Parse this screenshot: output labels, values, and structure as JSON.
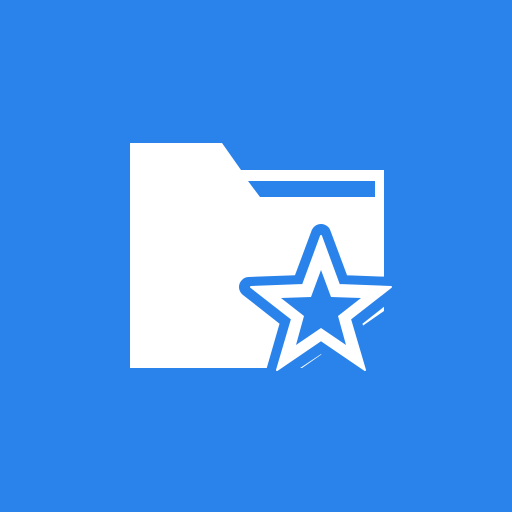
{
  "icon": {
    "name": "starred-folder-icon",
    "parts": [
      "folder-icon",
      "star-icon"
    ]
  },
  "colors": {
    "background": "#2A83EA",
    "foreground": "#FFFFFF"
  }
}
